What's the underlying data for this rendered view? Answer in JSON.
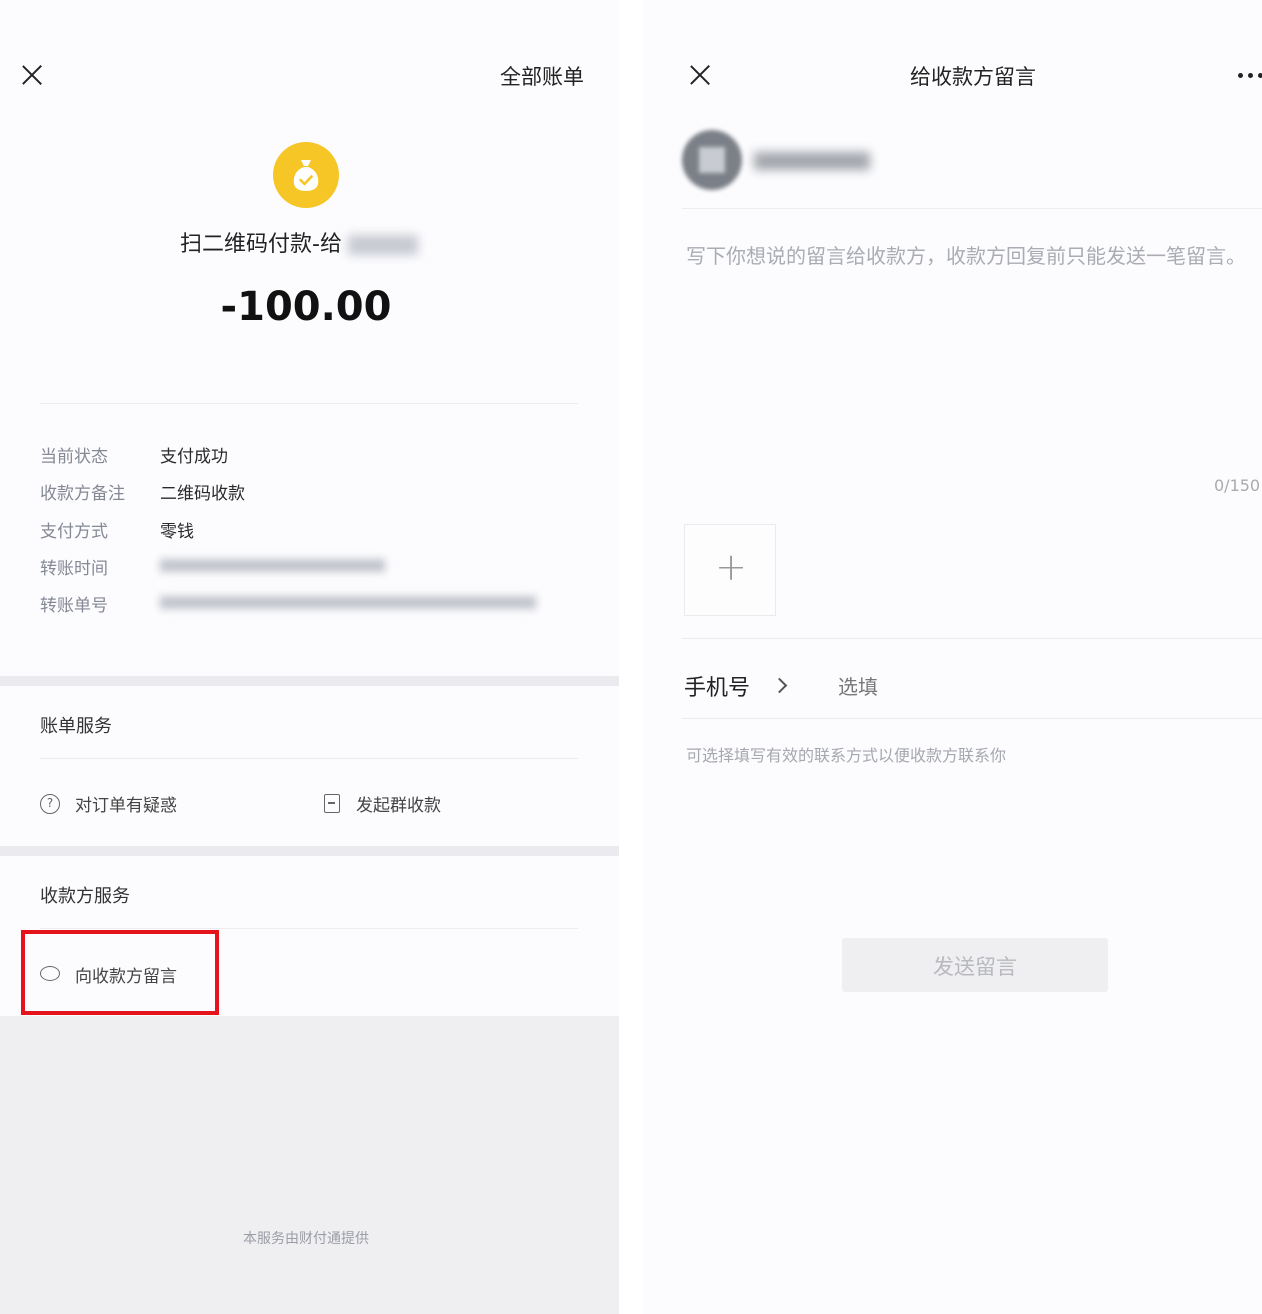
{
  "left": {
    "header_link": "全部账单",
    "merchant_prefix": "扫二维码付款-给",
    "amount": "-100.00",
    "details": [
      {
        "label": "当前状态",
        "value": "支付成功"
      },
      {
        "label": "收款方备注",
        "value": "二维码收款"
      },
      {
        "label": "支付方式",
        "value": "零钱"
      },
      {
        "label": "转账时间",
        "value": ""
      },
      {
        "label": "转账单号",
        "value": ""
      }
    ],
    "bill_service_title": "账单服务",
    "bill_services": [
      "对订单有疑惑",
      "发起群收款"
    ],
    "payee_service_title": "收款方服务",
    "payee_services": [
      "向收款方留言"
    ],
    "footer": "本服务由财付通提供"
  },
  "right": {
    "title": "给收款方留言",
    "placeholder": "写下你想说的留言给收款方，收款方回复前只能发送一笔留言。",
    "counter": "0/150",
    "add_glyph": "+",
    "phone_label": "手机号",
    "phone_placeholder": "选填",
    "contact_hint": "可选择填写有效的联系方式以便收款方联系你",
    "send_label": "发送留言"
  },
  "colors": {
    "coin": "#f6c626",
    "highlight": "#e5141c"
  },
  "icons": {
    "close": "close-icon",
    "coin": "money-bag-icon",
    "question": "question-circle-icon",
    "group": "document-icon",
    "message": "chat-bubble-icon",
    "more": "more-dots-icon",
    "chevron": "chevron-right-icon"
  }
}
